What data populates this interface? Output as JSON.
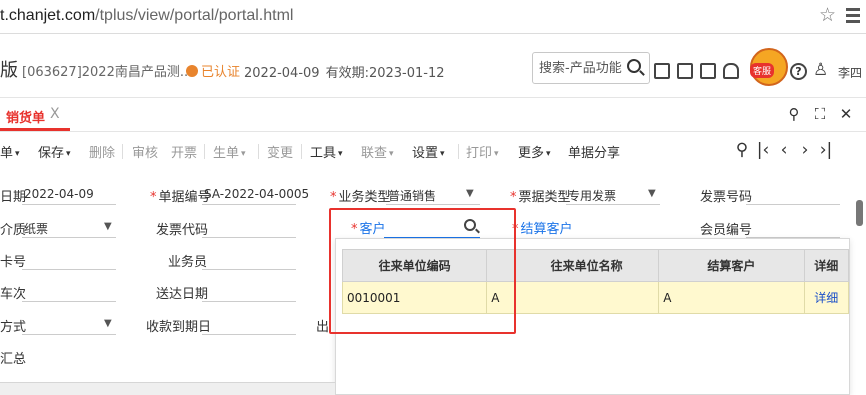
{
  "browser": {
    "url_host": "t.chanjet.com",
    "url_path": "/tplus/view/portal/portal.html"
  },
  "header": {
    "version_label": "版",
    "account": "[063627]2022南昌产品测...",
    "cert_label": "已认证",
    "date": "2022-04-09",
    "valid_until": "有效期:2023-01-12",
    "search_placeholder": "搜索-产品功能",
    "mascot_badge": "客服",
    "user_name": "李四"
  },
  "tab": {
    "label": "销货单",
    "close": "X"
  },
  "toolbar": {
    "items": [
      {
        "label": "单",
        "caret": "▾",
        "disabled": false
      },
      {
        "label": "保存",
        "caret": "▾",
        "disabled": false
      },
      {
        "label": "删除",
        "caret": "",
        "disabled": true
      },
      {
        "label": "审核",
        "caret": "",
        "disabled": true
      },
      {
        "label": "开票",
        "caret": "",
        "disabled": true
      },
      {
        "label": "生单",
        "caret": "▾",
        "disabled": true
      },
      {
        "label": "变更",
        "caret": "",
        "disabled": true
      },
      {
        "label": "工具",
        "caret": "▾",
        "disabled": false
      },
      {
        "label": "联查",
        "caret": "▾",
        "disabled": true
      },
      {
        "label": "设置",
        "caret": "▾",
        "disabled": false
      },
      {
        "label": "打印",
        "caret": "▾",
        "disabled": true
      },
      {
        "label": "更多",
        "caret": "▾",
        "disabled": false
      },
      {
        "label": "单据分享",
        "caret": "",
        "disabled": false
      }
    ]
  },
  "form": {
    "date_label": "日期",
    "date_value": "2022-04-09",
    "doc_no_label": "单据编号",
    "doc_no_value": "SA-2022-04-0005",
    "biz_type_label": "业务类型",
    "biz_type_value": "普通销售",
    "ticket_type_label": "票据类型",
    "ticket_type_value": "专用发票",
    "invoice_no_label": "发票号码",
    "medium_label": "介质",
    "medium_value": "纸票",
    "invoice_code_label": "发票代码",
    "customer_label": "客户",
    "settle_customer_label": "结算客户",
    "member_no_label": "会员编号",
    "card_no_label": "卡号",
    "salesman_label": "业务员",
    "trip_label": "车次",
    "delivery_date_label": "送达日期",
    "method_label": "方式",
    "receipt_due_label": "收款到期日",
    "partial_label": "出",
    "summary_label": "汇总"
  },
  "dropdown": {
    "columns": [
      "往来单位编码",
      "",
      "往来单位名称",
      "结算客户",
      "详细"
    ],
    "rows": [
      [
        "0010001",
        "A",
        "",
        "A",
        "详细"
      ]
    ]
  },
  "colors": {
    "accent": "#e8322d",
    "link": "#1a4fc9",
    "highlight_row": "#fff9cf"
  }
}
